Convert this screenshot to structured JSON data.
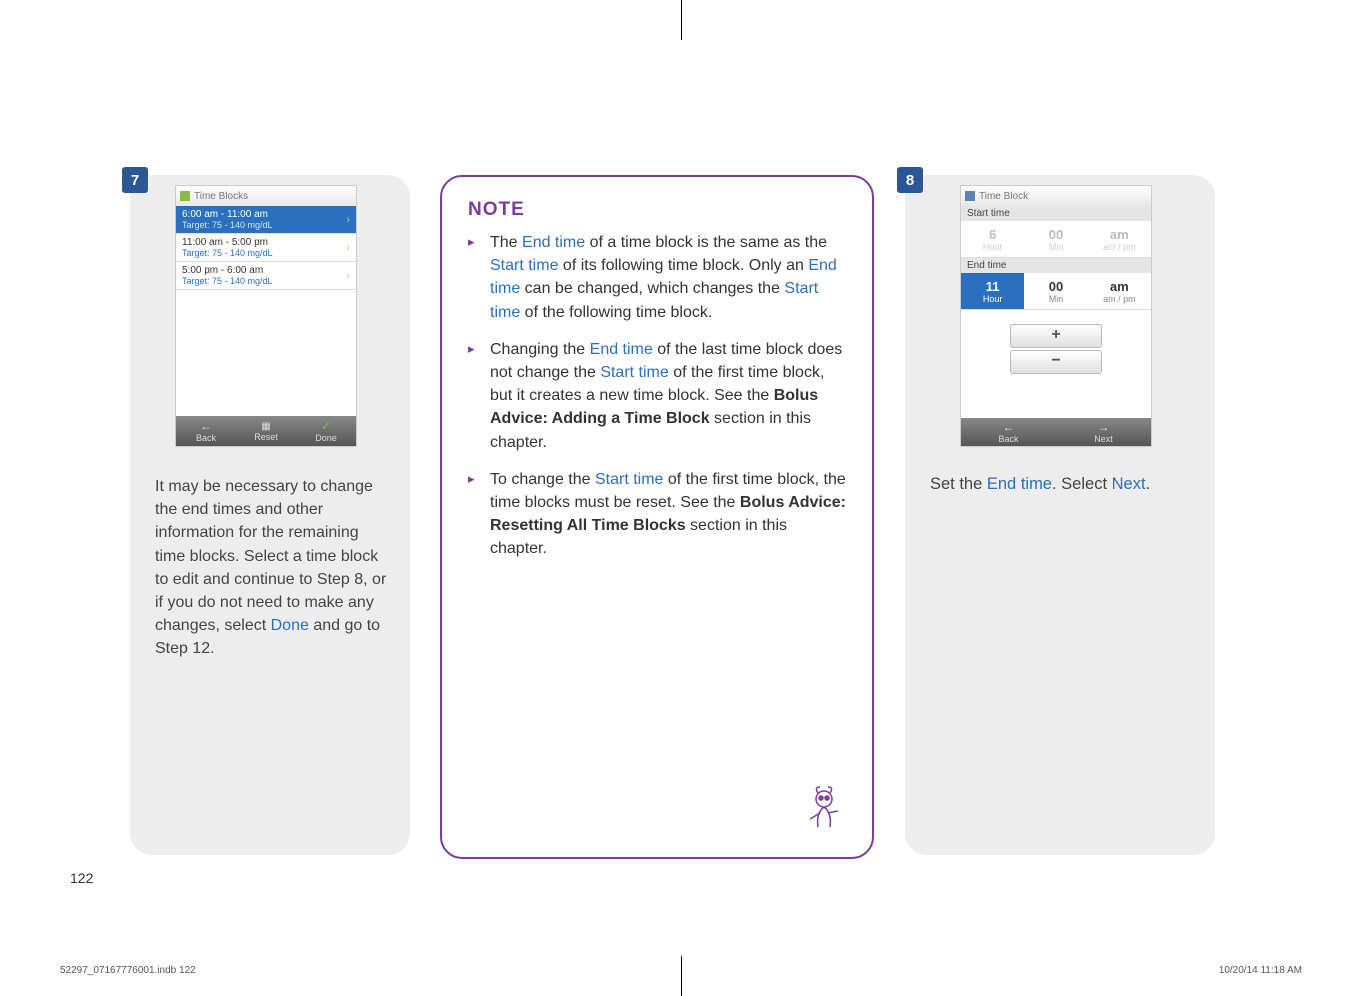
{
  "page_number": "122",
  "footer_left": "52297_07167776001.indb   122",
  "footer_right": "10/20/14   11:18 AM",
  "step7": {
    "badge": "7",
    "device_title": "Time Blocks",
    "rows": [
      {
        "range": "6:00 am - 11:00 am",
        "target": "Target: 75 - 140 mg/dL"
      },
      {
        "range": "11:00 am - 5:00 pm",
        "target": "Target: 75 - 140 mg/dL"
      },
      {
        "range": "5:00 pm - 6:00 am",
        "target": "Target: 75 - 140 mg/dL"
      }
    ],
    "buttons": {
      "back": "Back",
      "reset": "Reset",
      "done": "Done"
    },
    "caption_a": "It may be necessary to change the end times and other information for the remaining time blocks. Select a time block to edit and continue to Step 8, or if you do not need to make any changes, select ",
    "caption_link": "Done",
    "caption_b": " and go to Step 12."
  },
  "note": {
    "title": "NOTE",
    "item1": {
      "a": "The ",
      "h1": "End time",
      "b": " of a time block is the same as the ",
      "h2": "Start time",
      "c": " of its following time block. Only an ",
      "h3": "End time",
      "d": " can be changed, which changes the ",
      "h4": "Start time",
      "e": " of the following time block."
    },
    "item2": {
      "a": "Changing the ",
      "h1": "End time",
      "b": " of the last time block does not change the ",
      "h2": "Start time",
      "c": " of the first time block, but it creates a new time block. See the ",
      "bold": "Bolus Advice: Adding a Time Block",
      "d": " section in this chapter."
    },
    "item3": {
      "a": "To change the ",
      "h1": "Start time",
      "b": " of the first time block, the time blocks must be reset. See the ",
      "bold": "Bolus Advice: Resetting All Time Blocks",
      "c": " section in this chapter."
    }
  },
  "step8": {
    "badge": "8",
    "device_title": "Time Block",
    "start_label": "Start time",
    "end_label": "End time",
    "start": {
      "hour": "6",
      "hour_lbl": "Hour",
      "min": "00",
      "min_lbl": "Min",
      "ampm": "am",
      "ampm_lbl": "am / pm"
    },
    "end": {
      "hour": "11",
      "hour_lbl": "Hour",
      "min": "00",
      "min_lbl": "Min",
      "ampm": "am",
      "ampm_lbl": "am / pm"
    },
    "plus": "+",
    "minus": "−",
    "back": "Back",
    "next": "Next",
    "caption_a": "Set the ",
    "caption_h1": "End time",
    "caption_b": ". Select ",
    "caption_h2": "Next",
    "caption_c": "."
  }
}
